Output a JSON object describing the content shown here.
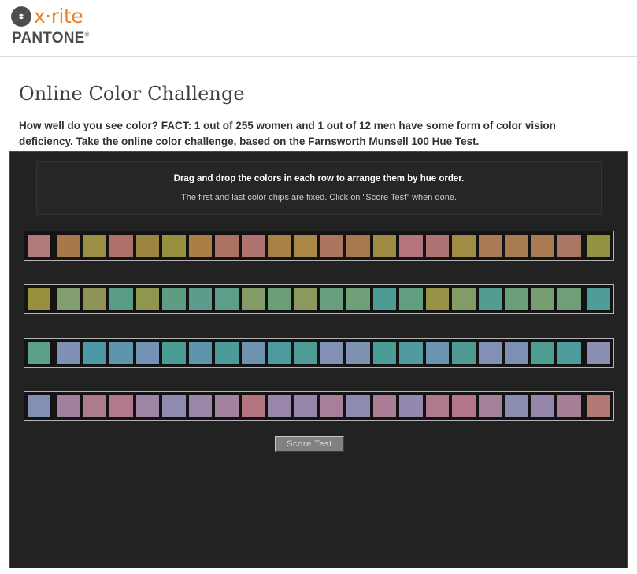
{
  "header": {
    "brand_primary": "x·rite",
    "brand_secondary": "PANTONE",
    "brand_secondary_mark": "®",
    "logo_icon": "xrite-x-icon",
    "brand_color": "#ee7f23",
    "brand_dark": "#4c4c4e"
  },
  "page": {
    "title": "Online Color Challenge",
    "description": "How well do you see color? FACT: 1 out of 255 women and 1 out of 12 men have some form of color vision deficiency. Take the online color challenge, based on the Farnsworth Munsell 100 Hue Test."
  },
  "test": {
    "instructions_primary": "Drag and drop the colors in each row to arrange them by hue order.",
    "instructions_secondary": "The first and last color chips are fixed. Click on \"Score Test\" when done.",
    "score_button_label": "Score Test",
    "panel_background": "#222222",
    "rows": [
      {
        "name": "row-red-orange-olive",
        "chips": [
          "#b17b7e",
          "#a8784b",
          "#9c8f43",
          "#ae7069",
          "#9c8540",
          "#96913f",
          "#ab7e45",
          "#ac7364",
          "#b07370",
          "#a98146",
          "#a98746",
          "#ab7560",
          "#a77a4d",
          "#a08b44",
          "#b3747d",
          "#b07373",
          "#a08c44",
          "#a87a55",
          "#a67c50",
          "#a87b52",
          "#ab7663",
          "#939240"
        ]
      },
      {
        "name": "row-olive-green-teal",
        "chips": [
          "#99903f",
          "#839f6f",
          "#8e9456",
          "#5a9d86",
          "#90954f",
          "#5f9d83",
          "#5c9c8d",
          "#5c9e8a",
          "#849d68",
          "#6c9f78",
          "#8a9a5f",
          "#679e7d",
          "#6f9f76",
          "#4e9b96",
          "#649e80",
          "#979246",
          "#839b67",
          "#549c90",
          "#6a9e7a",
          "#779e72",
          "#709e76",
          "#4e9d99"
        ]
      },
      {
        "name": "row-teal-blue-periwinkle",
        "chips": [
          "#5c9f8a",
          "#7f90b3",
          "#4d98a5",
          "#5f95ac",
          "#7392b6",
          "#4b9b95",
          "#5d96ab",
          "#4c9b98",
          "#6e93b0",
          "#4e9aa1",
          "#4d9c95",
          "#8190b3",
          "#7d91b1",
          "#4a9c96",
          "#519aa0",
          "#6a94b1",
          "#4f9b94",
          "#8190b4",
          "#7b90b3",
          "#4f9c92",
          "#509b9b",
          "#8b8fb4"
        ]
      },
      {
        "name": "row-slate-purple-rose",
        "chips": [
          "#8190b4",
          "#a1809f",
          "#ae7a8c",
          "#b2798c",
          "#9e84a5",
          "#8f8bb0",
          "#9a86a7",
          "#a1829f",
          "#b5757f",
          "#9886ab",
          "#9885ac",
          "#a77f99",
          "#8c8cb2",
          "#aa7c95",
          "#9287af",
          "#b07a8e",
          "#b2758a",
          "#a4819b",
          "#8b8cb1",
          "#9686ab",
          "#a77e96",
          "#b27874"
        ]
      }
    ]
  }
}
